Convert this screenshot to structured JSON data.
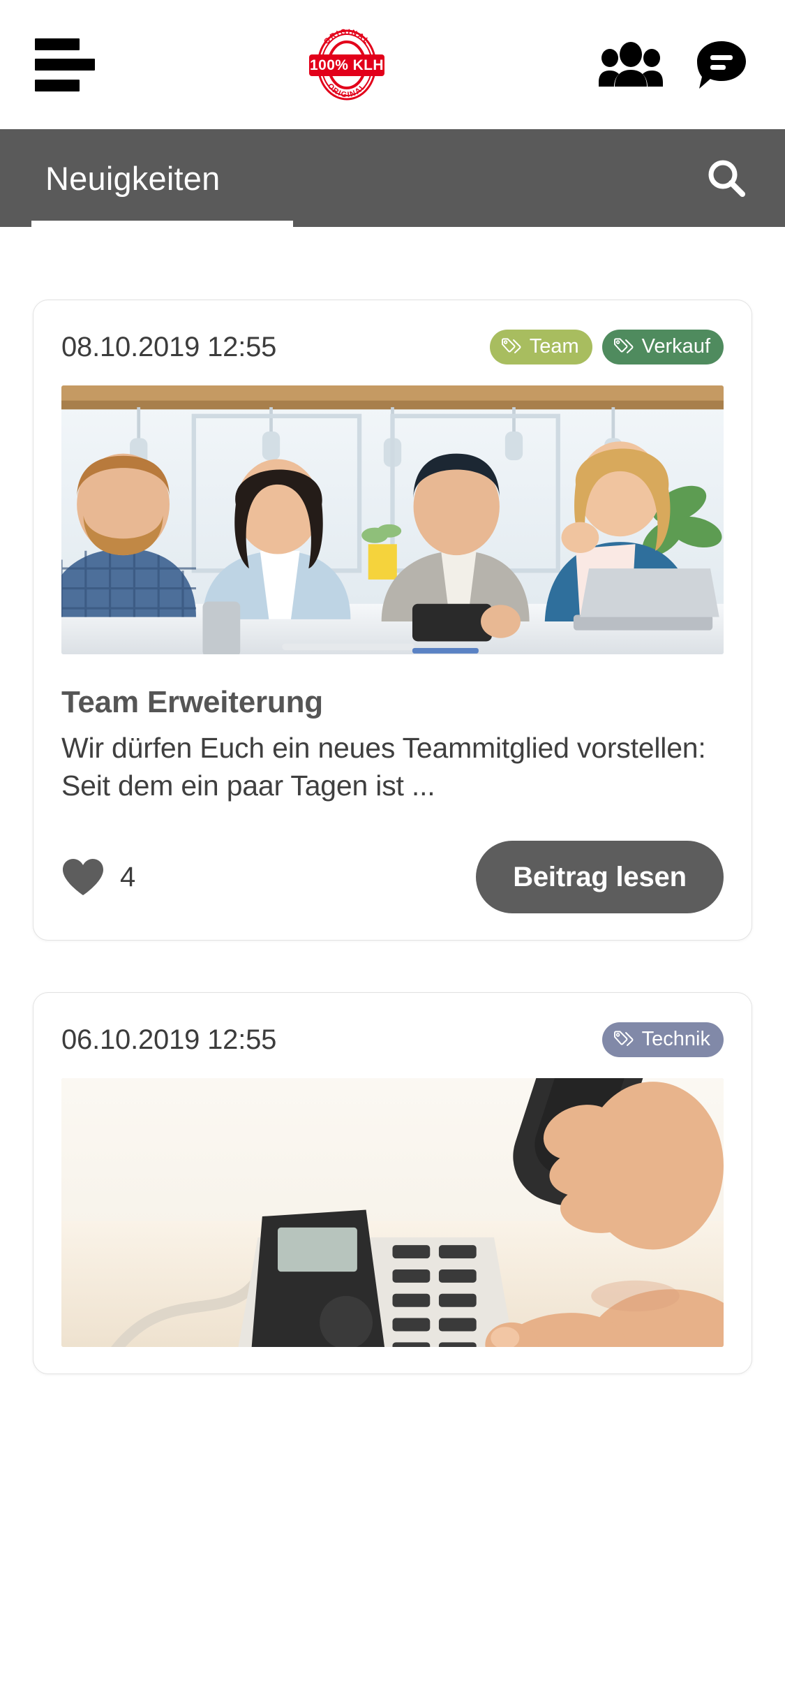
{
  "header": {
    "menu_icon": "hamburger-menu-icon",
    "logo": {
      "icon": "klh-original-stamp-logo",
      "center_text": "100% KLH",
      "top_arc_text": "ORIGINAL",
      "bottom_arc_text": "ORIGINAL",
      "color": "#e2001a"
    },
    "actions": [
      {
        "icon": "people-group-icon",
        "name": "contacts-button"
      },
      {
        "icon": "chat-bubble-icon",
        "name": "chat-button"
      }
    ]
  },
  "tabbar": {
    "title": "Neuigkeiten",
    "search_icon": "search-icon",
    "background": "#5a5a5a",
    "active_indicator_color": "#ffffff"
  },
  "feed": {
    "posts": [
      {
        "date": "08.10.2019 12:55",
        "tags": [
          {
            "label": "Team",
            "color": "#a8bd5f"
          },
          {
            "label": "Verkauf",
            "color": "#4f8b5e"
          }
        ],
        "image_alt": "Vier lachende Kollegen schauen gemeinsam auf ein Smartphone am Besprechungstisch",
        "title": "Team Erweiterung",
        "excerpt": "Wir dürfen Euch ein neues Teammitglied vorstellen: Seit dem ein paar Tagen ist ...",
        "like_count": "4",
        "like_icon": "heart-icon",
        "read_label": "Beitrag lesen"
      },
      {
        "date": "06.10.2019 12:55",
        "tags": [
          {
            "label": "Technik",
            "color": "#8189a8"
          }
        ],
        "image_alt": "Hand hebt den Hörer eines Tischtelefons ab und drückt eine Taste"
      }
    ]
  }
}
